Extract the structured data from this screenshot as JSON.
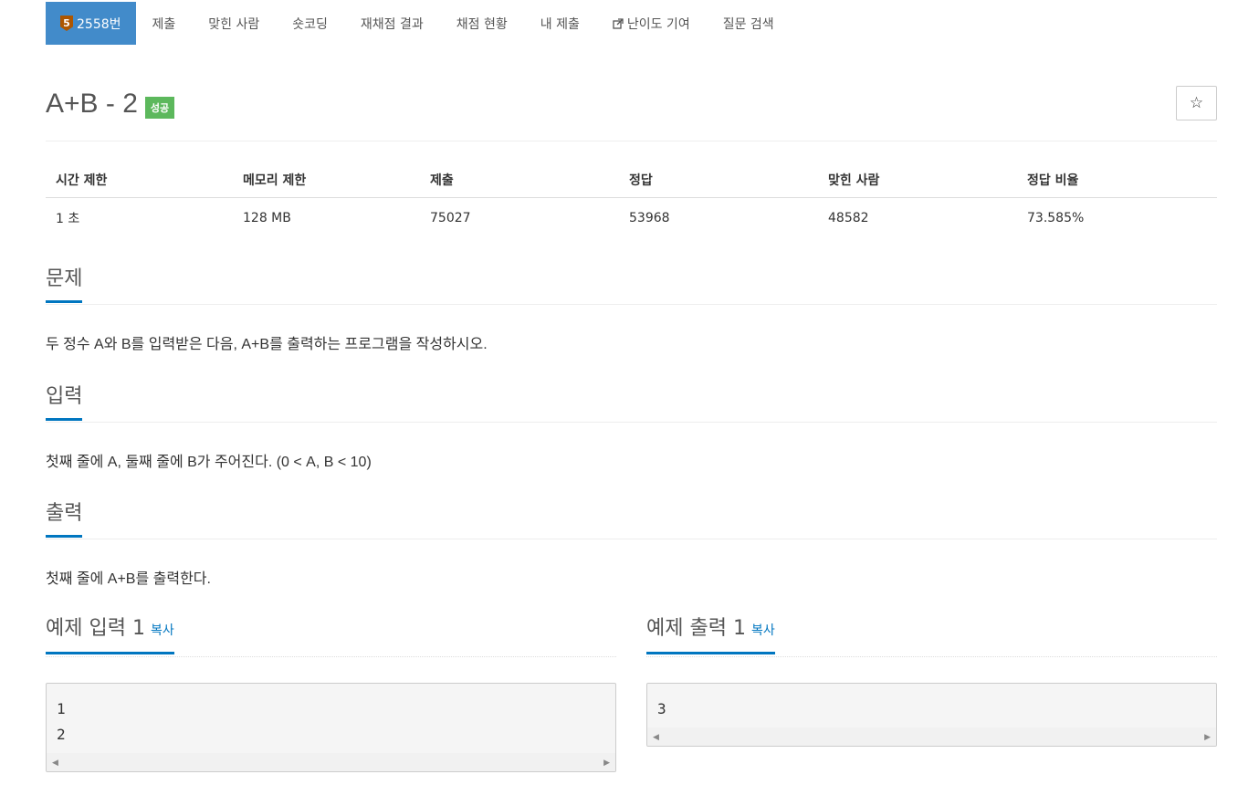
{
  "nav": {
    "problem_number": "2558번",
    "tier_level": "5",
    "items": [
      "제출",
      "맞힌 사람",
      "숏코딩",
      "재채점 결과",
      "채점 현황",
      "내 제출",
      "난이도 기여",
      "질문 검색"
    ]
  },
  "problem": {
    "title": "A+B - 2",
    "status_badge": "성공",
    "star_label": "☆"
  },
  "info_table": {
    "headers": [
      "시간 제한",
      "메모리 제한",
      "제출",
      "정답",
      "맞힌 사람",
      "정답 비율"
    ],
    "values": [
      "1 초",
      "128 MB",
      "75027",
      "53968",
      "48582",
      "73.585%"
    ]
  },
  "sections": {
    "problem": {
      "title": "문제",
      "body": "두 정수 A와 B를 입력받은 다음, A+B를 출력하는 프로그램을 작성하시오."
    },
    "input": {
      "title": "입력",
      "body": "첫째 줄에 A, 둘째 줄에 B가 주어진다. (0 < A, B < 10)"
    },
    "output": {
      "title": "출력",
      "body": "첫째 줄에 A+B를 출력한다."
    }
  },
  "samples": {
    "input": {
      "title": "예제 입력 1",
      "copy": "복사",
      "content": "1\n2"
    },
    "output": {
      "title": "예제 출력 1",
      "copy": "복사",
      "content": "3"
    }
  },
  "colors": {
    "nav_active": "#428bca",
    "tier_bronze": "#ad5600",
    "badge_success": "#5cb85c",
    "accent": "#0076c0"
  }
}
